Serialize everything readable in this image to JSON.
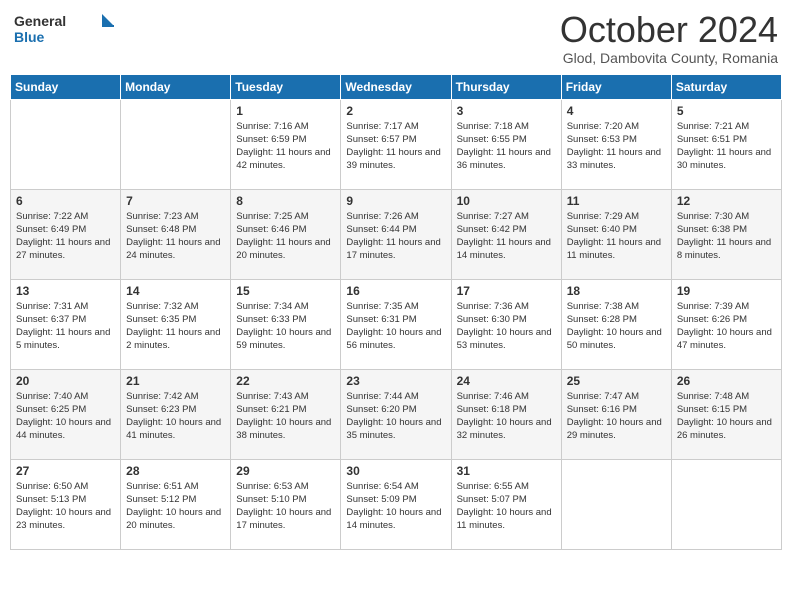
{
  "logo": {
    "general": "General",
    "blue": "Blue"
  },
  "title": {
    "month": "October 2024",
    "location": "Glod, Dambovita County, Romania"
  },
  "days_of_week": [
    "Sunday",
    "Monday",
    "Tuesday",
    "Wednesday",
    "Thursday",
    "Friday",
    "Saturday"
  ],
  "weeks": [
    [
      {
        "day": "",
        "info": ""
      },
      {
        "day": "",
        "info": ""
      },
      {
        "day": "1",
        "info": "Sunrise: 7:16 AM\nSunset: 6:59 PM\nDaylight: 11 hours and 42 minutes."
      },
      {
        "day": "2",
        "info": "Sunrise: 7:17 AM\nSunset: 6:57 PM\nDaylight: 11 hours and 39 minutes."
      },
      {
        "day": "3",
        "info": "Sunrise: 7:18 AM\nSunset: 6:55 PM\nDaylight: 11 hours and 36 minutes."
      },
      {
        "day": "4",
        "info": "Sunrise: 7:20 AM\nSunset: 6:53 PM\nDaylight: 11 hours and 33 minutes."
      },
      {
        "day": "5",
        "info": "Sunrise: 7:21 AM\nSunset: 6:51 PM\nDaylight: 11 hours and 30 minutes."
      }
    ],
    [
      {
        "day": "6",
        "info": "Sunrise: 7:22 AM\nSunset: 6:49 PM\nDaylight: 11 hours and 27 minutes."
      },
      {
        "day": "7",
        "info": "Sunrise: 7:23 AM\nSunset: 6:48 PM\nDaylight: 11 hours and 24 minutes."
      },
      {
        "day": "8",
        "info": "Sunrise: 7:25 AM\nSunset: 6:46 PM\nDaylight: 11 hours and 20 minutes."
      },
      {
        "day": "9",
        "info": "Sunrise: 7:26 AM\nSunset: 6:44 PM\nDaylight: 11 hours and 17 minutes."
      },
      {
        "day": "10",
        "info": "Sunrise: 7:27 AM\nSunset: 6:42 PM\nDaylight: 11 hours and 14 minutes."
      },
      {
        "day": "11",
        "info": "Sunrise: 7:29 AM\nSunset: 6:40 PM\nDaylight: 11 hours and 11 minutes."
      },
      {
        "day": "12",
        "info": "Sunrise: 7:30 AM\nSunset: 6:38 PM\nDaylight: 11 hours and 8 minutes."
      }
    ],
    [
      {
        "day": "13",
        "info": "Sunrise: 7:31 AM\nSunset: 6:37 PM\nDaylight: 11 hours and 5 minutes."
      },
      {
        "day": "14",
        "info": "Sunrise: 7:32 AM\nSunset: 6:35 PM\nDaylight: 11 hours and 2 minutes."
      },
      {
        "day": "15",
        "info": "Sunrise: 7:34 AM\nSunset: 6:33 PM\nDaylight: 10 hours and 59 minutes."
      },
      {
        "day": "16",
        "info": "Sunrise: 7:35 AM\nSunset: 6:31 PM\nDaylight: 10 hours and 56 minutes."
      },
      {
        "day": "17",
        "info": "Sunrise: 7:36 AM\nSunset: 6:30 PM\nDaylight: 10 hours and 53 minutes."
      },
      {
        "day": "18",
        "info": "Sunrise: 7:38 AM\nSunset: 6:28 PM\nDaylight: 10 hours and 50 minutes."
      },
      {
        "day": "19",
        "info": "Sunrise: 7:39 AM\nSunset: 6:26 PM\nDaylight: 10 hours and 47 minutes."
      }
    ],
    [
      {
        "day": "20",
        "info": "Sunrise: 7:40 AM\nSunset: 6:25 PM\nDaylight: 10 hours and 44 minutes."
      },
      {
        "day": "21",
        "info": "Sunrise: 7:42 AM\nSunset: 6:23 PM\nDaylight: 10 hours and 41 minutes."
      },
      {
        "day": "22",
        "info": "Sunrise: 7:43 AM\nSunset: 6:21 PM\nDaylight: 10 hours and 38 minutes."
      },
      {
        "day": "23",
        "info": "Sunrise: 7:44 AM\nSunset: 6:20 PM\nDaylight: 10 hours and 35 minutes."
      },
      {
        "day": "24",
        "info": "Sunrise: 7:46 AM\nSunset: 6:18 PM\nDaylight: 10 hours and 32 minutes."
      },
      {
        "day": "25",
        "info": "Sunrise: 7:47 AM\nSunset: 6:16 PM\nDaylight: 10 hours and 29 minutes."
      },
      {
        "day": "26",
        "info": "Sunrise: 7:48 AM\nSunset: 6:15 PM\nDaylight: 10 hours and 26 minutes."
      }
    ],
    [
      {
        "day": "27",
        "info": "Sunrise: 6:50 AM\nSunset: 5:13 PM\nDaylight: 10 hours and 23 minutes."
      },
      {
        "day": "28",
        "info": "Sunrise: 6:51 AM\nSunset: 5:12 PM\nDaylight: 10 hours and 20 minutes."
      },
      {
        "day": "29",
        "info": "Sunrise: 6:53 AM\nSunset: 5:10 PM\nDaylight: 10 hours and 17 minutes."
      },
      {
        "day": "30",
        "info": "Sunrise: 6:54 AM\nSunset: 5:09 PM\nDaylight: 10 hours and 14 minutes."
      },
      {
        "day": "31",
        "info": "Sunrise: 6:55 AM\nSunset: 5:07 PM\nDaylight: 10 hours and 11 minutes."
      },
      {
        "day": "",
        "info": ""
      },
      {
        "day": "",
        "info": ""
      }
    ]
  ]
}
